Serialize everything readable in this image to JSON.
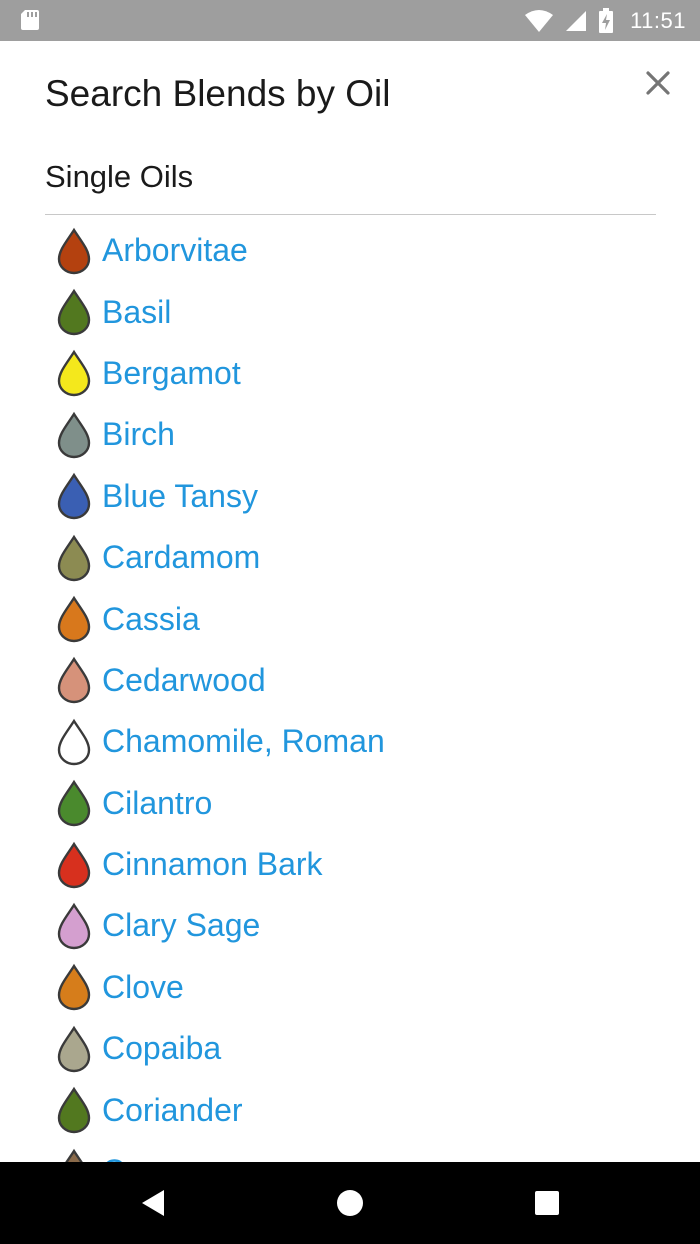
{
  "status_bar": {
    "time": "11:51",
    "icons": [
      "sd-card-icon",
      "wifi-icon",
      "cell-signal-icon",
      "battery-charging-icon"
    ]
  },
  "dialog": {
    "title": "Search Blends by Oil",
    "close_icon": "close-icon",
    "section_heading": "Single Oils",
    "oils": [
      {
        "name": "Arborvitae",
        "color": "#b4410f"
      },
      {
        "name": "Basil",
        "color": "#52781f"
      },
      {
        "name": "Bergamot",
        "color": "#f4e81c"
      },
      {
        "name": "Birch",
        "color": "#7f8f8a"
      },
      {
        "name": "Blue Tansy",
        "color": "#3a5fb3"
      },
      {
        "name": "Cardamom",
        "color": "#8c8b52"
      },
      {
        "name": "Cassia",
        "color": "#d8781c"
      },
      {
        "name": "Cedarwood",
        "color": "#d6927a"
      },
      {
        "name": "Chamomile, Roman",
        "color": "#ffffff"
      },
      {
        "name": "Cilantro",
        "color": "#4a8a2d"
      },
      {
        "name": "Cinnamon Bark",
        "color": "#d7301e"
      },
      {
        "name": "Clary Sage",
        "color": "#d49fcf"
      },
      {
        "name": "Clove",
        "color": "#d67d1b"
      },
      {
        "name": "Copaiba",
        "color": "#aaa78e"
      },
      {
        "name": "Coriander",
        "color": "#52781f"
      },
      {
        "name": "Cypress",
        "color": "#8a6a4a"
      }
    ]
  },
  "nav_bar": {
    "icons": [
      "back-icon",
      "home-icon",
      "recents-icon"
    ]
  }
}
